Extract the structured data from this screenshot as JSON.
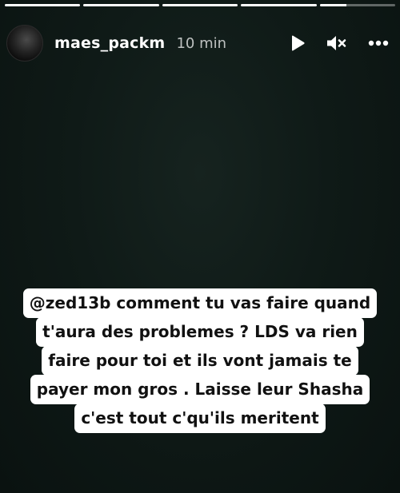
{
  "story": {
    "progress": [
      1,
      1,
      1,
      1,
      0.35
    ],
    "username": "maes_packm",
    "time": "10 min"
  },
  "icons": {
    "play": "play-icon",
    "mute": "speaker-muted-icon",
    "more": "more-horizontal-icon"
  },
  "caption": {
    "lines": [
      {
        "mention": "@zed13b",
        "text": " comment tu vas faire quand"
      },
      {
        "text": "t'aura des problemes ? LDS va rien"
      },
      {
        "text": "faire pour toi et ils vont jamais te"
      },
      {
        "text": "payer mon gros . Laisse leur Shasha"
      },
      {
        "text": "c'est tout c'qu'ils meritent"
      }
    ]
  }
}
